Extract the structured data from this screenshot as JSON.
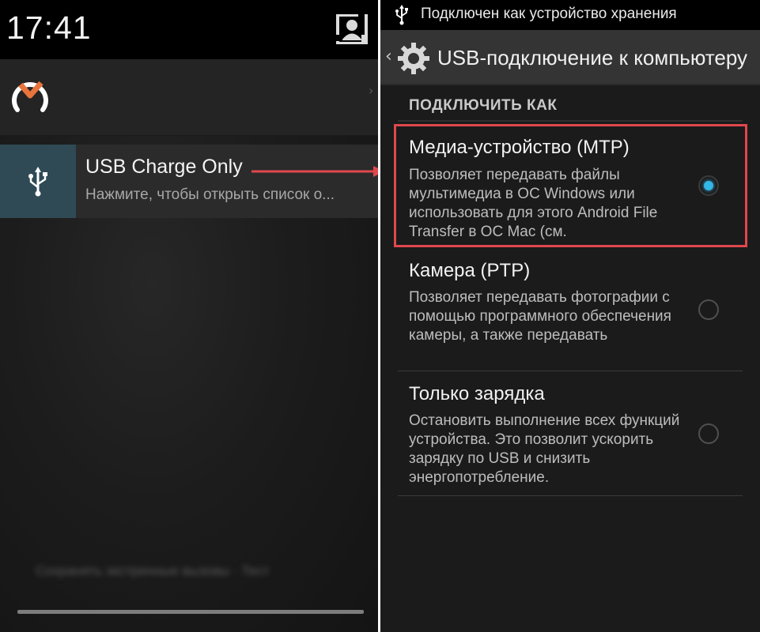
{
  "left": {
    "clock": "17:41",
    "notification": {
      "title": "USB Charge Only",
      "text": "Нажмите, чтобы открыть список о..."
    },
    "blurred_text": "Сохранять экстренные вызовы · Тест"
  },
  "right": {
    "status_text": "Подключен как устройство хранения",
    "action_bar_title": "USB-подключение к компьютеру",
    "section_header": "ПОДКЛЮЧИТЬ КАК",
    "options": [
      {
        "title": "Медиа-устройство (MTP)",
        "description": "Позволяет передавать файлы мультимедиа в ОС Windows или использовать для этого Android File Transfer в ОС Mac (см.",
        "selected": true
      },
      {
        "title": "Камера (PTP)",
        "description": "Позволяет передавать фотографии с помощью программного обеспечения камеры, а также передавать",
        "selected": false
      },
      {
        "title": "Только зарядка",
        "description": "Остановить выполнение всех функций устройства. Это позволит ускорить зарядку по USB и снизить энергопотребление.",
        "selected": false
      }
    ]
  },
  "colors": {
    "accent": "#33b5e5",
    "highlight_box": "#e0474c",
    "notification_icon_bg": "#2f4a55"
  },
  "icons": [
    "quick-settings-icon",
    "app-logo-icon",
    "usb-icon",
    "back-chevron-icon",
    "gear-icon",
    "radio-selected-icon",
    "radio-unselected-icon"
  ]
}
